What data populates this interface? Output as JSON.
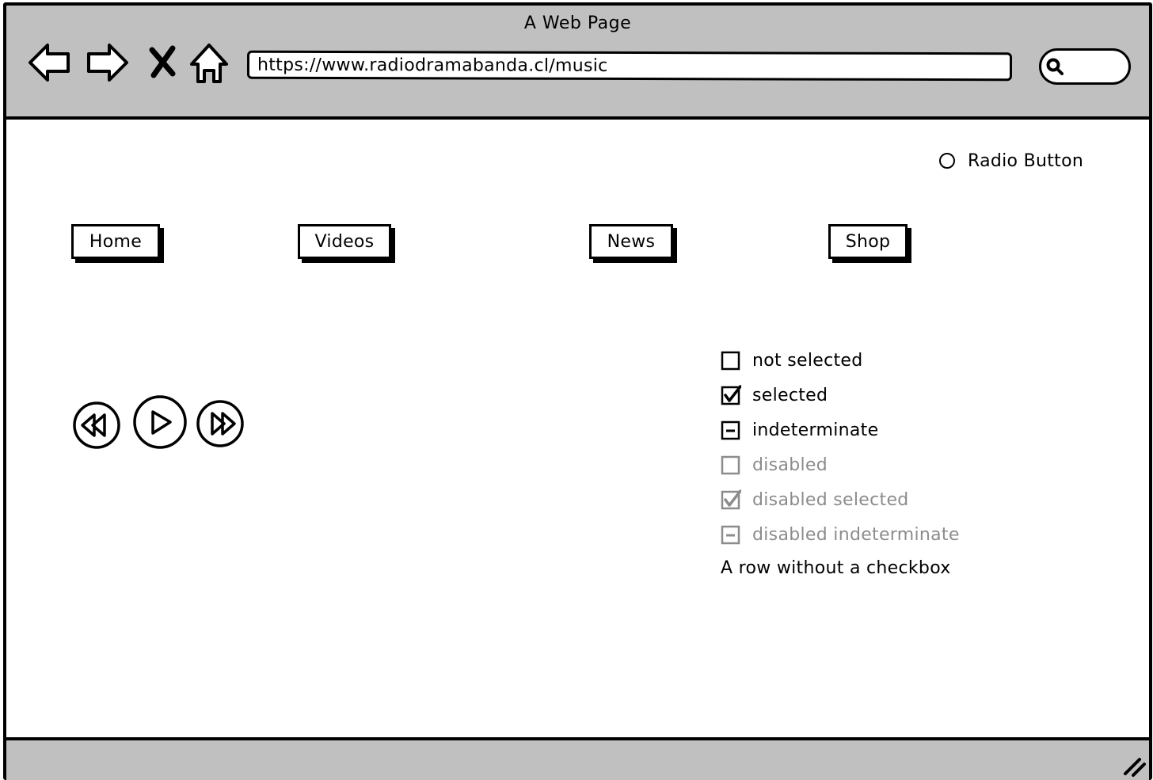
{
  "window": {
    "title": "A Web Page"
  },
  "toolbar": {
    "back_icon": "arrow-left-icon",
    "forward_icon": "arrow-right-icon",
    "stop_icon": "close-icon",
    "home_icon": "home-icon"
  },
  "address_bar": {
    "url": "https://www.radiodramabanda.cl/music"
  },
  "search": {
    "icon": "search-icon"
  },
  "radio_button": {
    "label": "Radio Button",
    "selected": false
  },
  "nav_buttons": [
    {
      "label": "Home"
    },
    {
      "label": "Videos"
    },
    {
      "label": "News"
    },
    {
      "label": "Shop"
    }
  ],
  "media_controls": {
    "rewind_icon": "rewind-icon",
    "play_icon": "play-icon",
    "fast_forward_icon": "fast-forward-icon"
  },
  "checklist": [
    {
      "label": "not selected",
      "state": "unchecked",
      "disabled": false
    },
    {
      "label": "selected",
      "state": "checked",
      "disabled": false
    },
    {
      "label": "indeterminate",
      "state": "indeterminate",
      "disabled": false
    },
    {
      "label": "disabled",
      "state": "unchecked",
      "disabled": true
    },
    {
      "label": "disabled selected",
      "state": "checked",
      "disabled": true
    },
    {
      "label": "disabled indeterminate",
      "state": "indeterminate",
      "disabled": true
    },
    {
      "label": "A row without a checkbox",
      "state": "none",
      "disabled": false
    }
  ],
  "colors": {
    "chrome": "#c0c0c0",
    "ink": "#000000",
    "disabled": "#8c8c8c",
    "page": "#ffffff"
  }
}
